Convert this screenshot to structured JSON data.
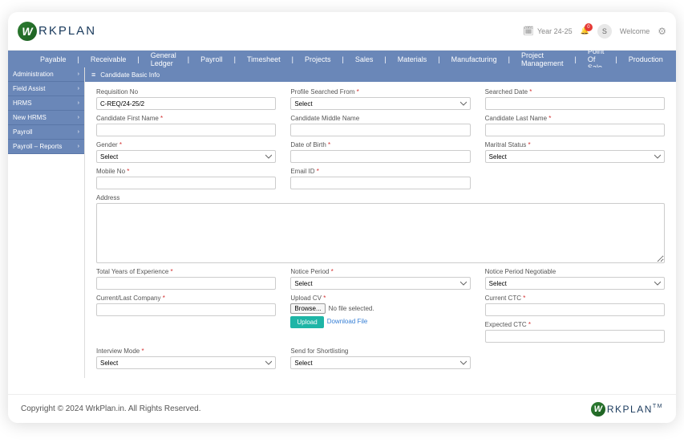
{
  "header": {
    "logo_letter": "W",
    "logo_rest": "RKPLAN",
    "year": "Year 24-25",
    "notification_count": "0",
    "avatar_letter": "S",
    "welcome": "Welcome"
  },
  "topnav": [
    "Payable",
    "Receivable",
    "General Ledger",
    "Payroll",
    "Timesheet",
    "Projects",
    "Sales",
    "Materials",
    "Manufacturing",
    "Project Management",
    "Point Of Sale",
    "Production"
  ],
  "sidebar": [
    {
      "label": "Administration"
    },
    {
      "label": "Field Assist"
    },
    {
      "label": "HRMS"
    },
    {
      "label": "New HRMS"
    },
    {
      "label": "Payroll"
    },
    {
      "label": "Payroll – Reports"
    }
  ],
  "content_title": "Candidate Basic Info",
  "form": {
    "requisition_no": {
      "label": "Requisition No",
      "value": "C-REQ/24-25/2"
    },
    "profile_searched_from": {
      "label": "Profile Searched From ",
      "value": "Select"
    },
    "searched_date": {
      "label": "Searched Date "
    },
    "first_name": {
      "label": "Candidate First Name "
    },
    "middle_name": {
      "label": "Candidate Middle Name"
    },
    "last_name": {
      "label": "Candidate Last Name "
    },
    "gender": {
      "label": "Gender ",
      "value": "Select"
    },
    "dob": {
      "label": "Date of Birth "
    },
    "marital": {
      "label": "Maritral Status ",
      "value": "Select"
    },
    "mobile": {
      "label": "Mobile No "
    },
    "email": {
      "label": "Email ID "
    },
    "address": {
      "label": "Address"
    },
    "experience": {
      "label": "Total Years of Experience "
    },
    "notice_period": {
      "label": "Notice Period ",
      "value": "Select"
    },
    "notice_negotiable": {
      "label": "Notice Period Negotiable",
      "value": "Select"
    },
    "company": {
      "label": "Current/Last Company "
    },
    "upload_cv": {
      "label": "Upload CV ",
      "browse": "Browse...",
      "nofile": "No file selected.",
      "upload": "Upload",
      "download": "Download File"
    },
    "current_ctc": {
      "label": "Current CTC "
    },
    "expected_ctc": {
      "label": "Expected CTC "
    },
    "interview_mode": {
      "label": "Interview Mode ",
      "value": "Select"
    },
    "send_shortlisting": {
      "label": "Send for Shortlisting",
      "value": "Select"
    }
  },
  "footer": {
    "copyright": "Copyright © 2024 WrkPlan.in. All Rights Reserved.",
    "tm": "TM"
  }
}
